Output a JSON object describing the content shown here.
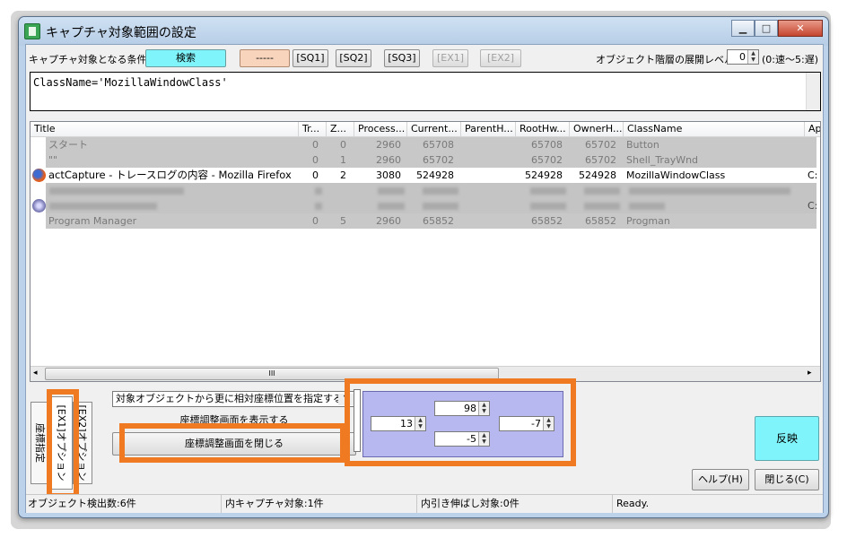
{
  "window": {
    "title": "キャプチャ対象範囲の設定",
    "btn_minimize": "▁",
    "btn_maximize": "□",
    "btn_close": "✕"
  },
  "toolbar": {
    "condition_label": "キャプチャ対象となる条件:",
    "search_button": "検索",
    "dash_button": "-----",
    "sq1": "[SQ1]",
    "sq2": "[SQ2]",
    "sq3": "[SQ3]",
    "ex1": "[EX1]",
    "ex2": "[EX2]",
    "expand_level_label": "オブジェクト階層の展開レベル:",
    "expand_level_value": "0",
    "expand_level_hint": "(0:速〜5:遅)"
  },
  "condition_text": "ClassName='MozillaWindowClass'",
  "table": {
    "columns": [
      "Title",
      "Tr...",
      "Z...",
      "Process...",
      "Current...",
      "ParentH...",
      "RootHw...",
      "OwnerH...",
      "ClassName",
      "Ap"
    ],
    "rows": [
      {
        "title": "スタート",
        "tr": "0",
        "z": "0",
        "process": "2960",
        "current": "65708",
        "parent": "",
        "root": "65708",
        "owner": "65702",
        "classname": "Button",
        "ap": ""
      },
      {
        "title": "\"\"",
        "tr": "0",
        "z": "1",
        "process": "2960",
        "current": "65702",
        "parent": "",
        "root": "65702",
        "owner": "65702",
        "classname": "Shell_TrayWnd",
        "ap": ""
      },
      {
        "title": "actCapture - トレースログの内容 - Mozilla Firefox",
        "tr": "0",
        "z": "2",
        "process": "3080",
        "current": "524928",
        "parent": "",
        "root": "524928",
        "owner": "524928",
        "classname": "MozillaWindowClass",
        "ap": "C:"
      },
      {
        "title": "Program Manager",
        "tr": "0",
        "z": "5",
        "process": "2960",
        "current": "65852",
        "parent": "",
        "root": "65852",
        "owner": "65852",
        "classname": "Progman",
        "ap": ""
      }
    ],
    "blurred_row_ap": "C:",
    "hscroll_grip": "III"
  },
  "tabs": {
    "tab1": "座標指定",
    "tab2": "[EX1]オプション",
    "tab3": "[EX2]オプション"
  },
  "options": {
    "relative_select": "対象オブジェクトから更に相対座標位置を指定する",
    "show_adjust": "座標調整画面を表示する",
    "close_adjust": "座標調整画面を閉じる"
  },
  "offsets": {
    "top": "98",
    "left": "13",
    "right": "-7",
    "bottom": "-5"
  },
  "buttons": {
    "apply": "反映",
    "help": "ヘルプ(H)",
    "close": "閉じる(C)"
  },
  "status": {
    "detected": "オブジェクト検出数:6件",
    "capture_targets": "内キャプチャ対象:1件",
    "stretch_targets": "内引き伸ばし対象:0件",
    "ready": "Ready."
  },
  "colors": {
    "search_button": "#7ff5fb",
    "dash_button": "#f8d4bd",
    "apply_button": "#7ff5fb",
    "offset_panel": "#b8b8f0",
    "highlight": "#f07a22"
  }
}
